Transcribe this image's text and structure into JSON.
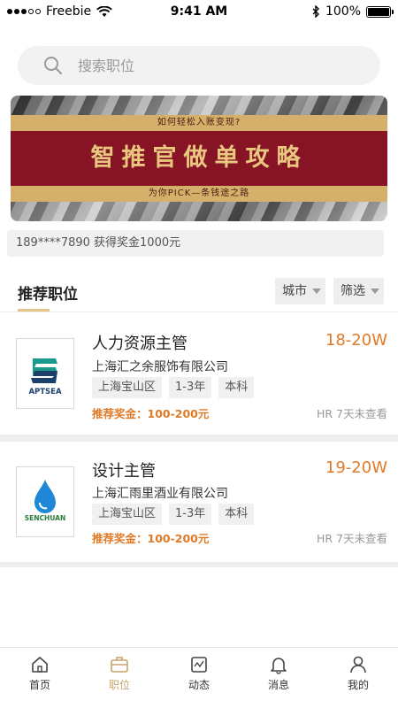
{
  "status_bar": {
    "carrier": "Freebie",
    "time": "9:41 AM",
    "battery": "100%"
  },
  "search": {
    "placeholder": "搜索职位"
  },
  "banner": {
    "top_text": "如何轻松入账变现?",
    "main_text": "智推官做单攻略",
    "bottom_text": "为你PICK—条钱途之路"
  },
  "ticker": {
    "text": "189****7890 获得奖金1000元"
  },
  "section": {
    "title": "推荐职位",
    "filters": [
      {
        "label": "城市"
      },
      {
        "label": "筛选"
      }
    ]
  },
  "jobs": [
    {
      "title": "人力资源主管",
      "salary": "18-20W",
      "company": "上海汇之余服饰有限公司",
      "tags": [
        "上海宝山区",
        "1-3年",
        "本科"
      ],
      "bonus": "推荐奖金：100-200元",
      "hr_status": "HR 7天未查看",
      "logo": {
        "icon": "aptsea-logo",
        "text": "APTSEA",
        "colors": [
          "#1a9a8a",
          "#1b3f6b"
        ]
      }
    },
    {
      "title": "设计主管",
      "salary": "19-20W",
      "company": "上海汇雨里酒业有限公司",
      "tags": [
        "上海宝山区",
        "1-3年",
        "本科"
      ],
      "bonus": "推荐奖金：100-200元",
      "hr_status": "HR 7天未查看",
      "logo": {
        "icon": "senchuan-logo",
        "text": "SENCHUAN",
        "colors": [
          "#1e88d6",
          "#2a7a3a"
        ]
      }
    }
  ],
  "tab_bar": {
    "items": [
      {
        "label": "首页",
        "icon": "home-icon"
      },
      {
        "label": "职位",
        "icon": "briefcase-icon",
        "active": true
      },
      {
        "label": "动态",
        "icon": "activity-icon"
      },
      {
        "label": "消息",
        "icon": "bell-icon"
      },
      {
        "label": "我的",
        "icon": "user-icon"
      }
    ]
  },
  "colors": {
    "accent": "#e07a26",
    "gold": "#c9a46a",
    "banner_red": "#861425"
  }
}
